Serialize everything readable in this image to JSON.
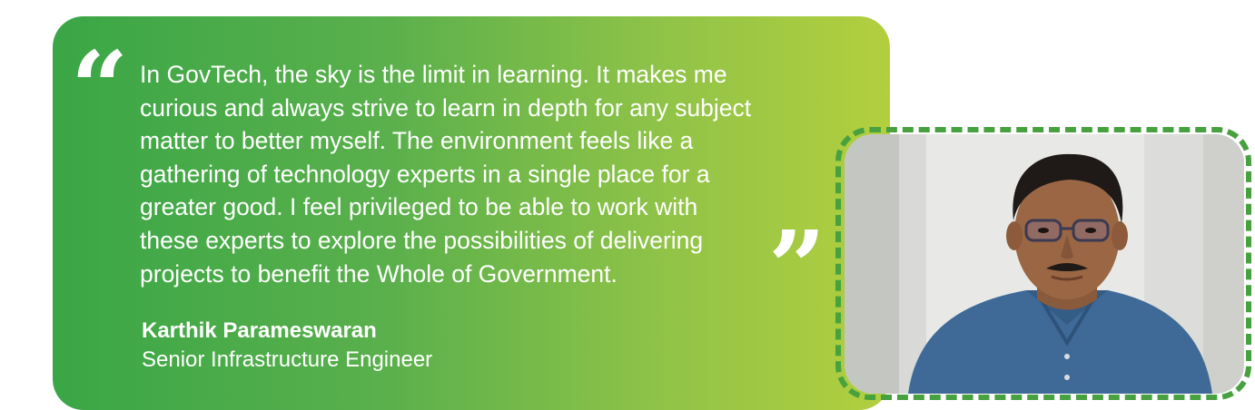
{
  "quote": {
    "open_icon": "open-quote-icon",
    "close_icon": "close-quote-icon",
    "text": "In GovTech, the sky is the limit in learning. It makes me\ncurious and always strive to learn in depth for any subject\nmatter to better myself. The environment feels like a\ngathering of technology experts in a single place for a\ngreater good. I feel privileged to be able to work with\nthese experts to explore the possibilities of delivering\nprojects to benefit the Whole of Government."
  },
  "author": {
    "name": "Karthik Parameswaran",
    "title": "Senior Infrastructure Engineer"
  },
  "colors": {
    "gradient_start": "#3aa646",
    "gradient_end": "#b3cf3e",
    "frame_dash": "#47a13f",
    "text": "#ffffff"
  },
  "photo": {
    "subject": "portrait-photo"
  }
}
